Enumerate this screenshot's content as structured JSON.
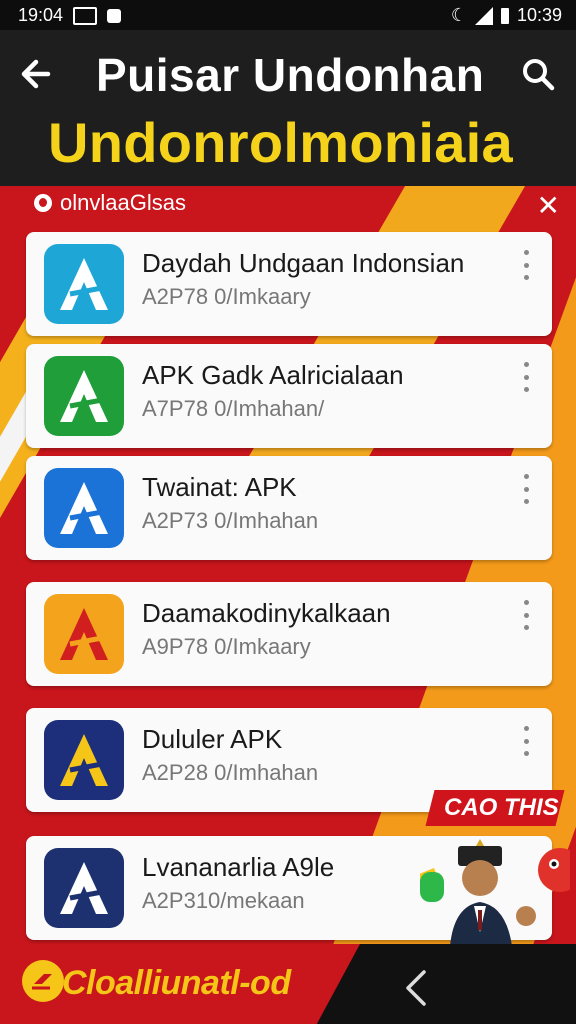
{
  "status_bar": {
    "time_left": "19:04",
    "time_right": "10:39"
  },
  "header": {
    "title": "Puisar Undonhan",
    "subtitle": "Undonrolmoniaia"
  },
  "banner": {
    "label": "olnvlaaGlsas"
  },
  "apps": [
    {
      "name": "Daydah Undgaan Indonsian",
      "meta": "A2P78 0/Imkaary",
      "icon_bg": "#1ea6d6",
      "icon_fg": "#ffffff"
    },
    {
      "name": "APK Gadk Aalricialaan",
      "meta": "A7P78 0/Imhahan/",
      "icon_bg": "#1f9e3a",
      "icon_fg": "#ffffff"
    },
    {
      "name": "Twainat: APK",
      "meta": "A2P73 0/Imhahan",
      "icon_bg": "#1b73d8",
      "icon_fg": "#ffffff"
    },
    {
      "name": "Daamakodinykalkaan",
      "meta": "A9P78 0/Imkaary",
      "icon_bg": "#f3a41c",
      "icon_fg": "#d11f1f"
    },
    {
      "name": "Dululer APK",
      "meta": "A2P28 0/Imhahan",
      "icon_bg": "#1d2f7a",
      "icon_fg": "#f5c518"
    },
    {
      "name": "Lvananarlia A9le",
      "meta": "A2P310/mekaan",
      "icon_bg": "#1d3170",
      "icon_fg": "#ffffff"
    }
  ],
  "promo": {
    "tag": "CAO THIS"
  },
  "bottom": {
    "label": "Cloalliunatl-od"
  },
  "colors": {
    "header_bg": "#1e1e1e",
    "subtitle": "#f5d31b",
    "banner_red": "#c8161c",
    "accent_orange": "#f39a1a"
  }
}
